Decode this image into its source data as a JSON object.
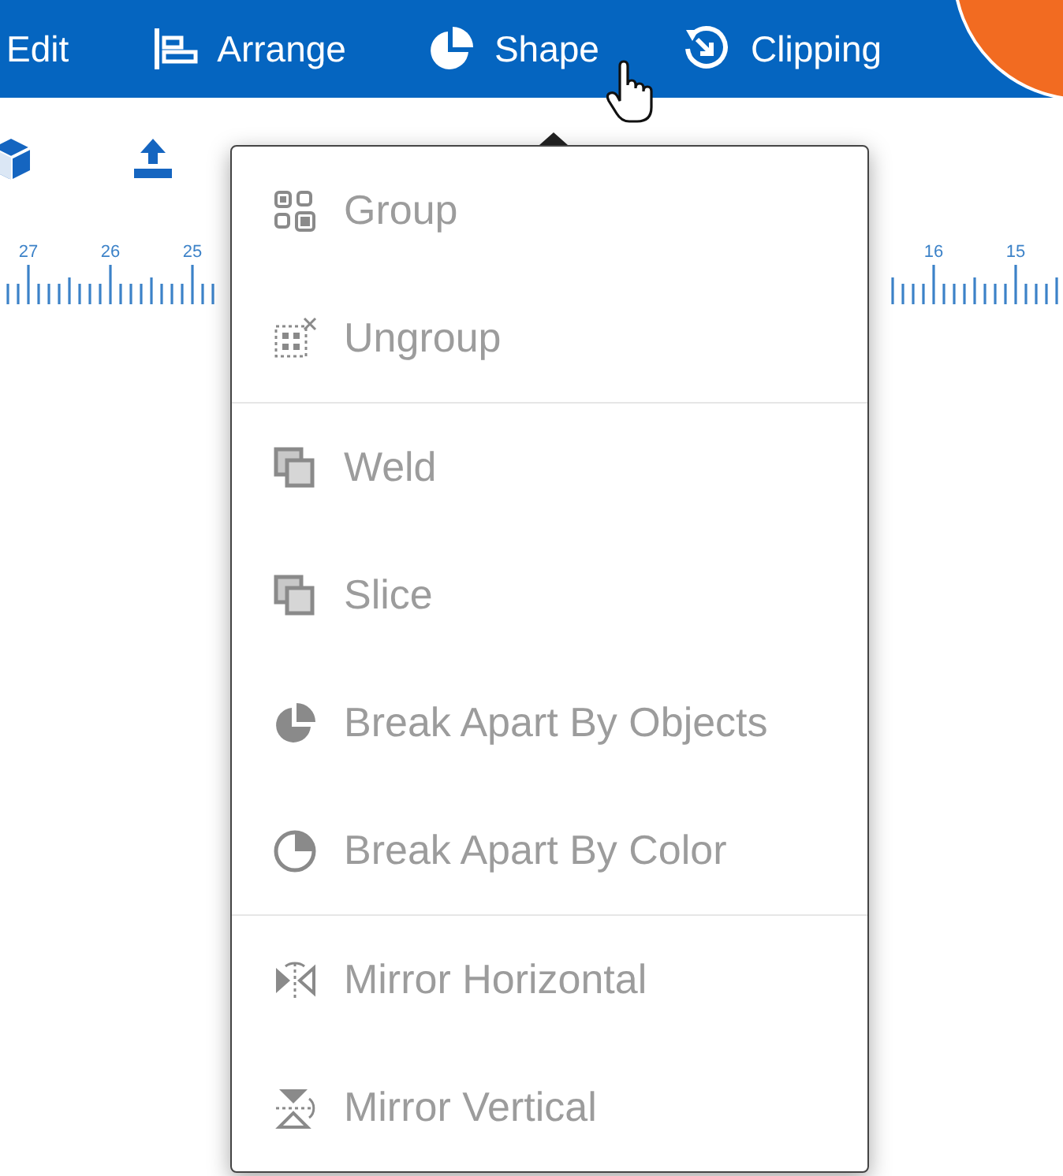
{
  "menu_bar": {
    "items": [
      {
        "label": "Edit"
      },
      {
        "label": "Arrange"
      },
      {
        "label": "Shape"
      },
      {
        "label": "Clipping"
      }
    ]
  },
  "ruler": {
    "left_labels": [
      "27",
      "26",
      "25"
    ],
    "right_labels": [
      "16",
      "15"
    ]
  },
  "shape_menu": {
    "groups": [
      {
        "items": [
          {
            "label": "Group",
            "disabled": true
          },
          {
            "label": "Ungroup",
            "disabled": true
          }
        ]
      },
      {
        "items": [
          {
            "label": "Weld",
            "disabled": true
          },
          {
            "label": "Slice",
            "disabled": true
          },
          {
            "label": "Break Apart By Objects",
            "disabled": true
          },
          {
            "label": "Break Apart By Color",
            "disabled": true
          }
        ]
      },
      {
        "items": [
          {
            "label": "Mirror Horizontal",
            "disabled": true
          },
          {
            "label": "Mirror Vertical",
            "disabled": true
          }
        ]
      }
    ]
  }
}
